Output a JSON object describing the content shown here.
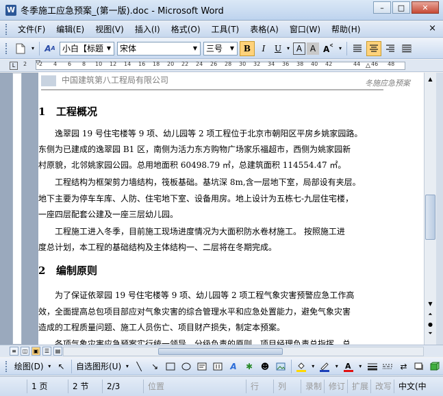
{
  "window": {
    "app_icon": "W",
    "title": "冬季施工应急预案_(第一版).doc - Microsoft Word",
    "minimize": "–",
    "maximize": "□",
    "close": "✕"
  },
  "menu": {
    "items": [
      "文件(F)",
      "编辑(E)",
      "视图(V)",
      "插入(I)",
      "格式(O)",
      "工具(T)",
      "表格(A)",
      "窗口(W)",
      "帮助(H)"
    ],
    "close_doc": "×"
  },
  "formatting": {
    "style_value": "小白【标题",
    "font_value": "宋体",
    "size_value": "三号",
    "bold_label": "B",
    "italic_label": "I",
    "underline_label": "U",
    "font_color_label": "A",
    "char_shade_label": "A"
  },
  "ruler": {
    "ticks": [
      "2",
      "2",
      "4",
      "6",
      "8",
      "10",
      "12",
      "14",
      "16",
      "18",
      "20",
      "22",
      "24",
      "26",
      "28",
      "30",
      "32",
      "34",
      "36",
      "38",
      "40",
      "42",
      "44",
      "46",
      "48"
    ]
  },
  "document": {
    "header_company": "中国建筑第八工程局有限公司",
    "header_right": "冬施应急预案",
    "sections": [
      {
        "num": "1",
        "title": "工程概况",
        "lines": [
          "　　逸翠园 19 号住宅楼等 9 项、幼儿园等 2 项工程位于北京市朝阳区平房乡姚家园路。",
          "东侧为已建成的逸翠园 B1 区，南侧为活力东方购物广场家乐福超市，西侧为姚家园新",
          "村原貌，北邻姚家园公园。总用地面积 60498.79 ㎡，总建筑面积 114554.47 ㎡。",
          "　　工程结构为框架剪力墙结构，筏板基础。基坑深 8m,含一层地下室，局部设有夹层。",
          "地下主要为停车车库、人防、住宅地下室、设备用房。地上设计为五栋七-九层住宅楼，",
          "一座四层配套公建及一座三层幼儿园。",
          "　　工程施工进入冬季，目前施工现场进度情况为大面积防水卷材施工。 按照施工进",
          "度总计划，本工程的基础结构及主体结构一、二层将在冬期完成。"
        ]
      },
      {
        "num": "2",
        "title": "编制原则",
        "lines": [
          "　　为了保证依翠园 19 号住宅楼等 9 项、幼儿园等 2 项工程气象灾害预警应急工作高",
          "效，全面提高总包项目部应对气象灾害的综合管理水平和应急处置能力，避免气象灾害",
          "造成的工程质量问题、施工人员伤亡、项目财产损失，制定本预案。",
          "　　各项气象灾害应急预案实行统一领导，分级负责的原则，项目经理负责总指挥，总"
        ]
      }
    ]
  },
  "drawing": {
    "draw_label": "绘图(D)",
    "autoshapes_label": "自选图形(U)"
  },
  "status": {
    "page": "1 页",
    "section": "2 节",
    "page_of": "2/3",
    "position": "位置",
    "line": "行",
    "col": "列",
    "rec": "录制",
    "trk": "修订",
    "ext": "扩展",
    "ovr": "改写",
    "language": "中文(中"
  }
}
